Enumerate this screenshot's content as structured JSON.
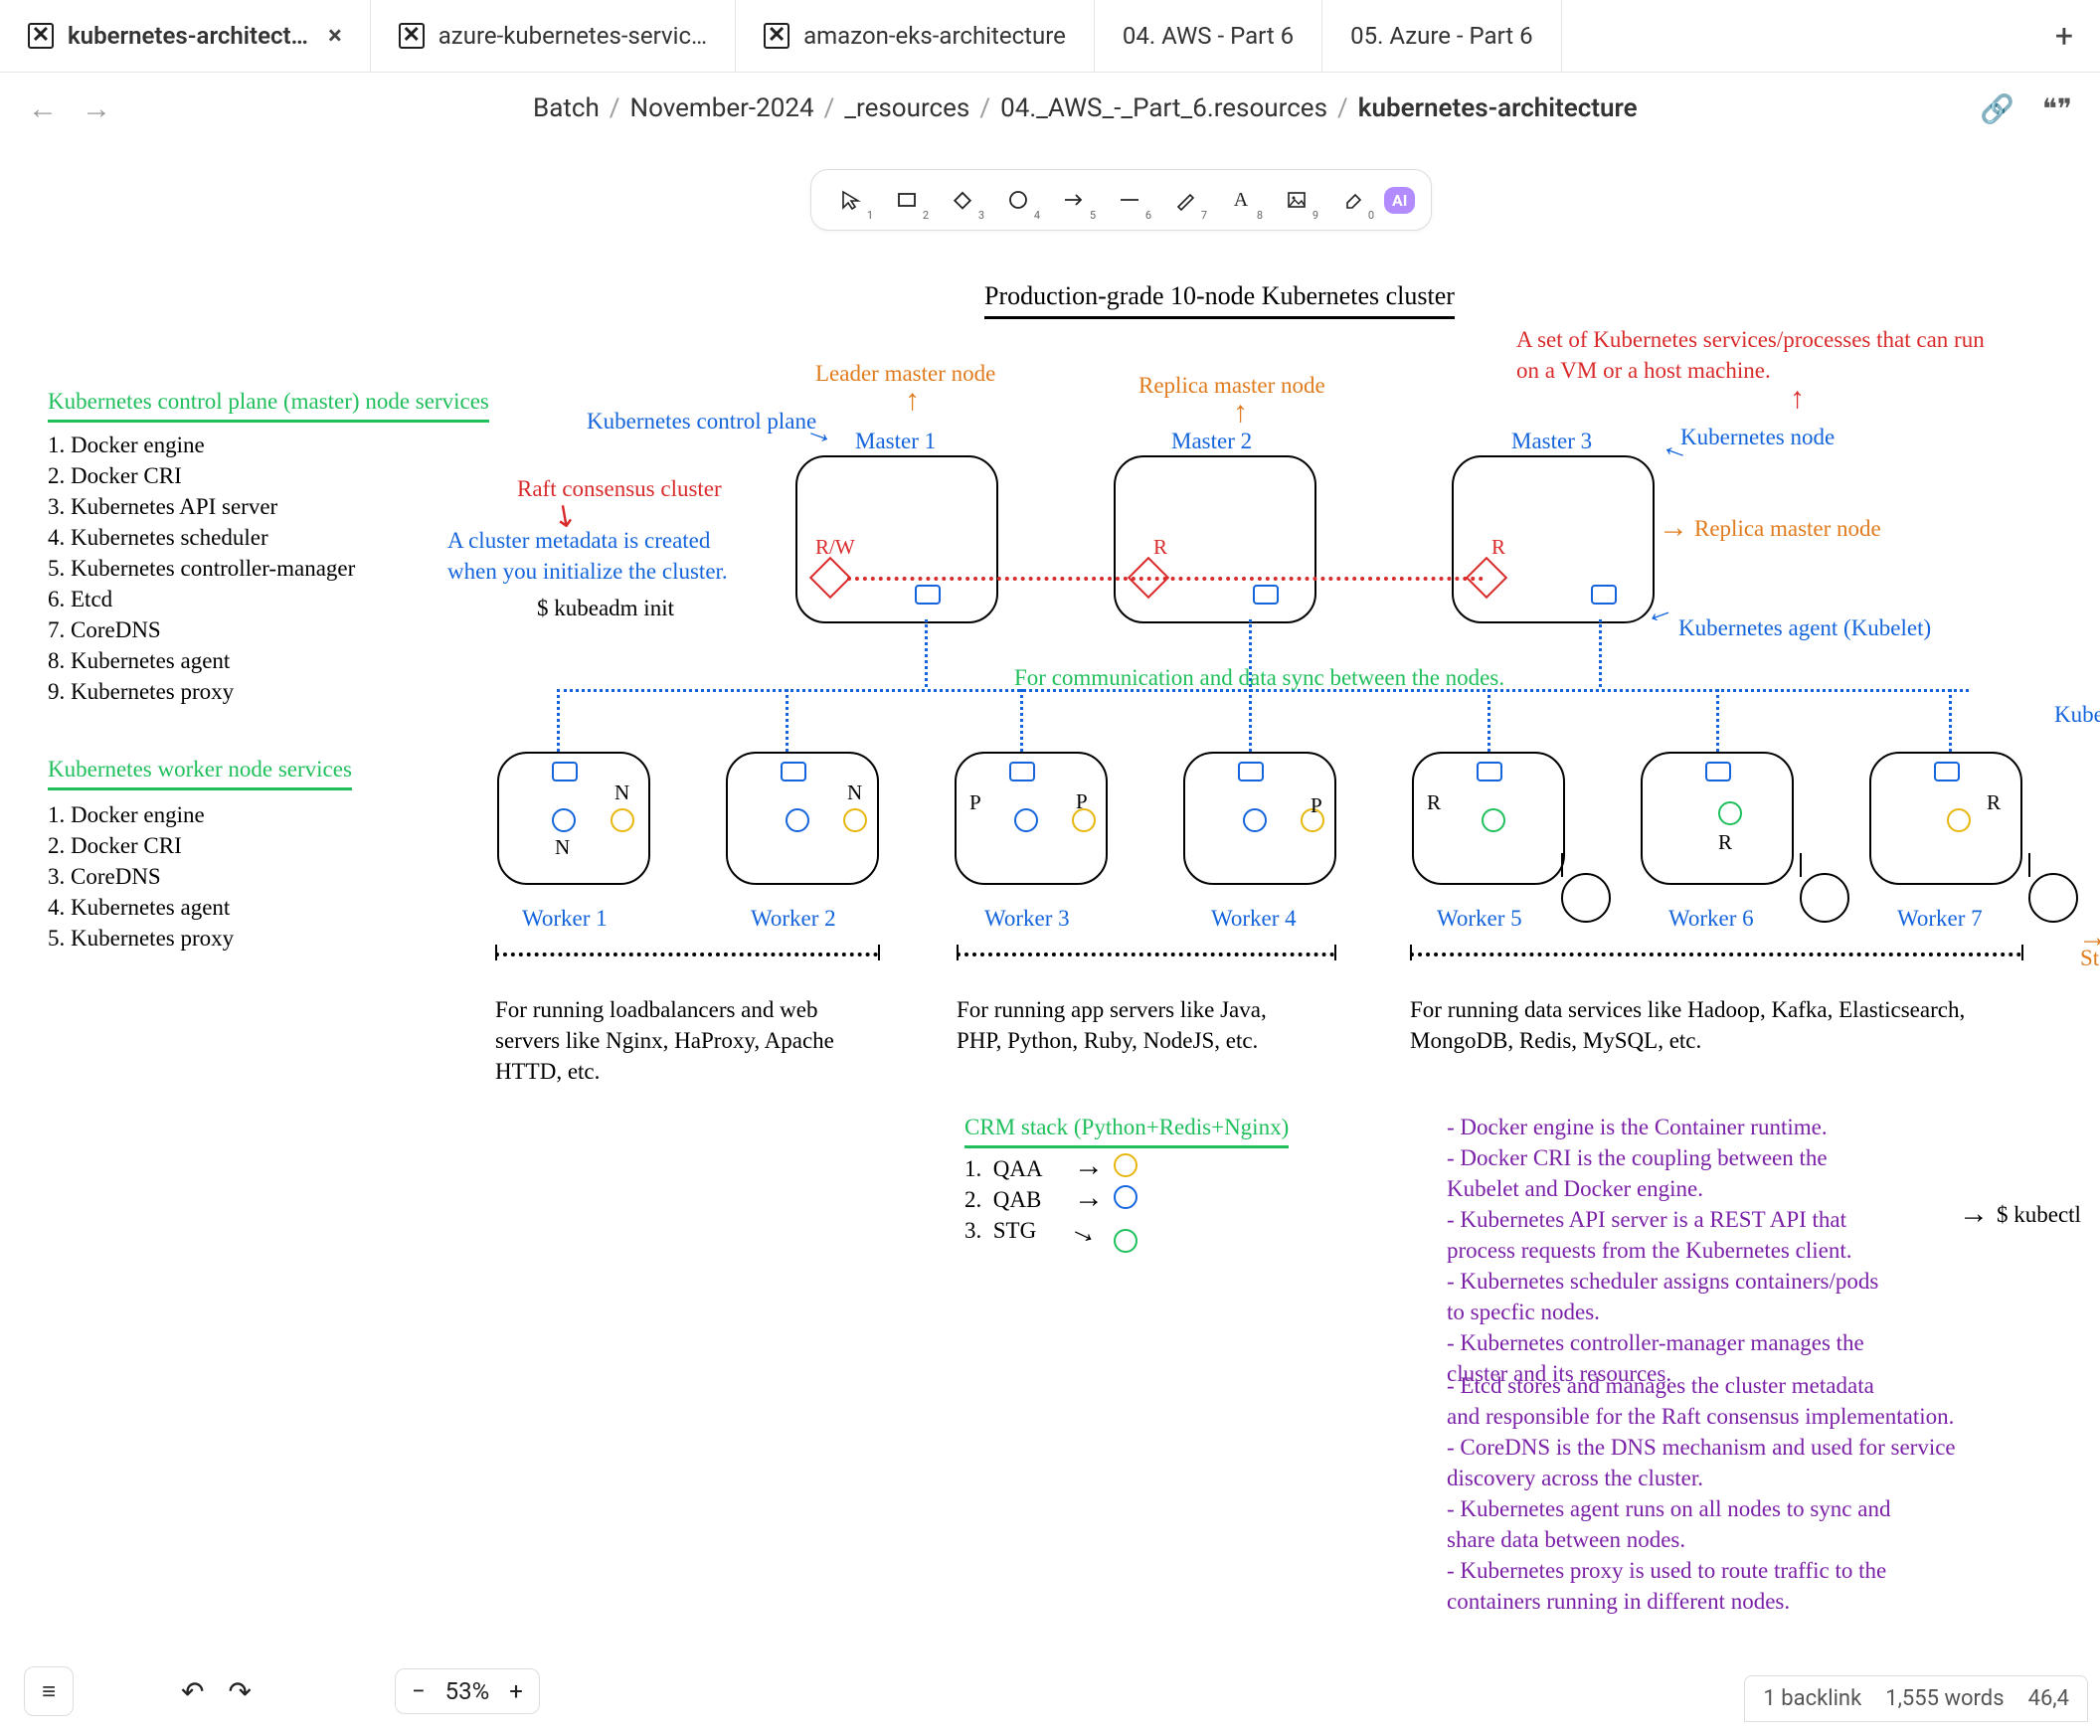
{
  "tabs": {
    "items": [
      {
        "label": "kubernetes-architect…",
        "has_icon": true,
        "active": true,
        "closable": true
      },
      {
        "label": "azure-kubernetes-servic…",
        "has_icon": true
      },
      {
        "label": "amazon-eks-architecture",
        "has_icon": true
      },
      {
        "label": "04. AWS - Part 6"
      },
      {
        "label": "05. Azure - Part 6"
      }
    ],
    "add": "+"
  },
  "breadcrumbs": {
    "back": "←",
    "fwd": "→",
    "parts": [
      "Batch",
      "November-2024",
      "_resources",
      "04._AWS_-_Part_6.resources"
    ],
    "current": "kubernetes-architecture",
    "link_icon": "🔗",
    "quote_icon": "❝❞"
  },
  "toolbar": {
    "items": [
      {
        "name": "select",
        "sub": "1"
      },
      {
        "name": "rectangle",
        "sub": "2"
      },
      {
        "name": "diamond",
        "sub": "3"
      },
      {
        "name": "ellipse",
        "sub": "4"
      },
      {
        "name": "arrow",
        "sub": "5"
      },
      {
        "name": "line",
        "sub": "6"
      },
      {
        "name": "draw",
        "sub": "7"
      },
      {
        "name": "text",
        "sub": "8"
      },
      {
        "name": "image",
        "sub": "9"
      },
      {
        "name": "eraser",
        "sub": "0"
      }
    ],
    "ai": "AI"
  },
  "diagram": {
    "title": "Production-grade 10-node Kubernetes cluster",
    "cp_heading": "Kubernetes control plane (master) node services",
    "cp_list": "1. Docker engine\n2. Docker CRI\n3. Kubernetes API server\n4. Kubernetes scheduler\n5. Kubernetes controller-manager\n6. Etcd\n7. CoreDNS\n8. Kubernetes agent\n9. Kubernetes proxy",
    "wk_heading": "Kubernetes worker node services",
    "wk_list": "1. Docker engine\n2. Docker CRI\n3. CoreDNS\n4. Kubernetes agent\n5. Kubernetes proxy",
    "raft": "Raft consensus cluster",
    "meta1": "A cluster metadata is created\nwhen you initialize the cluster.",
    "kubeadm": "$ kubeadm init",
    "leader": "Leader master node",
    "replica_top": "Replica master node",
    "cp_label": "Kubernetes control plane",
    "master1": "Master 1",
    "master2": "Master 2",
    "master3": "Master 3",
    "rw": "R/W",
    "r": "R",
    "svc_note": "A set of Kubernetes services/processes that can run\non a VM or a host machine.",
    "knode": "Kubernetes node",
    "replica_r": "Replica master node",
    "kagent": "Kubernetes agent (Kubelet)",
    "sync": "For communication and data sync between the nodes.",
    "kuber_tail": "Kuber",
    "workers": [
      "Worker 1",
      "Worker 2",
      "Worker 3",
      "Worker 4",
      "Worker 5",
      "Worker 6",
      "Worker 7"
    ],
    "n": "N",
    "p": "P",
    "r2": "R",
    "st_tail": "St",
    "grp1": "For running loadbalancers and web\nservers like Nginx, HaProxy, Apache\nHTTD, etc.",
    "grp2": "For running app servers like Java,\nPHP, Python, Ruby, NodeJS, etc.",
    "grp3": "For running data services like Hadoop, Kafka, Elasticsearch,\nMongoDB, Redis, MySQL, etc.",
    "crm_title": "CRM stack (Python+Redis+Nginx)",
    "crm_list": "1.  QAA\n2.  QAB\n3.  STG",
    "notes1": "- Docker engine is the Container runtime.\n- Docker CRI is the coupling between the\nKubelet and Docker engine.\n- Kubernetes API server is a REST API that\nprocess requests from the Kubernetes client.\n- Kubernetes scheduler assigns containers/pods\nto specfic nodes.\n- Kubernetes controller-manager manages the\ncluster and its resources.",
    "notes2": "- Etcd stores and manages the cluster metadata\nand responsible for the Raft consensus implementation.\n- CoreDNS is the DNS mechanism and used for service\ndiscovery across the cluster.\n- Kubernetes agent runs on all nodes to sync and\nshare data between nodes.\n- Kubernetes proxy is used to route traffic to the\ncontainers running in different nodes.",
    "kubectl": "$ kubectl"
  },
  "footer": {
    "menu": "≡",
    "undo": "↶",
    "redo": "↷",
    "zoom_out": "−",
    "zoom": "53%",
    "zoom_in": "+",
    "backlinks": "1 backlink",
    "words": "1,555 words",
    "chars": "46,4"
  }
}
